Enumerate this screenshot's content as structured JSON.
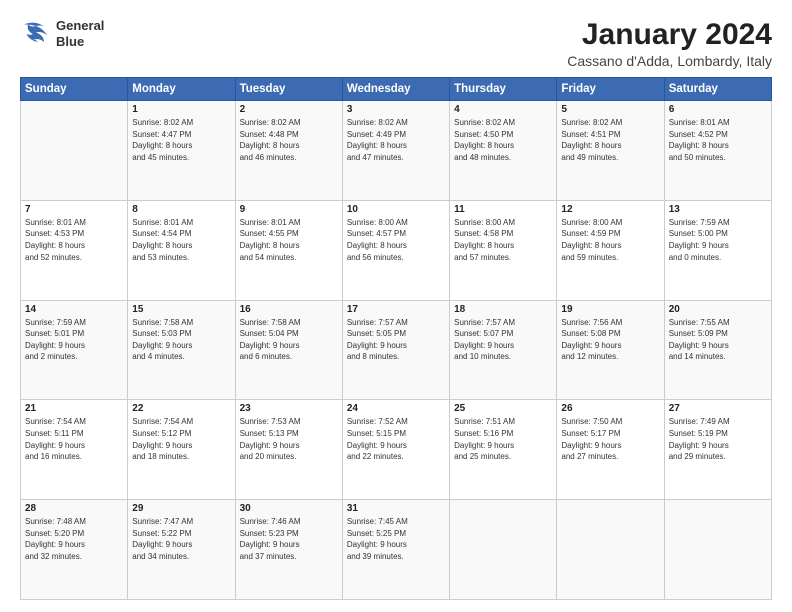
{
  "header": {
    "logo_line1": "General",
    "logo_line2": "Blue",
    "month": "January 2024",
    "location": "Cassano d'Adda, Lombardy, Italy"
  },
  "weekdays": [
    "Sunday",
    "Monday",
    "Tuesday",
    "Wednesday",
    "Thursday",
    "Friday",
    "Saturday"
  ],
  "weeks": [
    [
      {
        "day": "",
        "info": ""
      },
      {
        "day": "1",
        "info": "Sunrise: 8:02 AM\nSunset: 4:47 PM\nDaylight: 8 hours\nand 45 minutes."
      },
      {
        "day": "2",
        "info": "Sunrise: 8:02 AM\nSunset: 4:48 PM\nDaylight: 8 hours\nand 46 minutes."
      },
      {
        "day": "3",
        "info": "Sunrise: 8:02 AM\nSunset: 4:49 PM\nDaylight: 8 hours\nand 47 minutes."
      },
      {
        "day": "4",
        "info": "Sunrise: 8:02 AM\nSunset: 4:50 PM\nDaylight: 8 hours\nand 48 minutes."
      },
      {
        "day": "5",
        "info": "Sunrise: 8:02 AM\nSunset: 4:51 PM\nDaylight: 8 hours\nand 49 minutes."
      },
      {
        "day": "6",
        "info": "Sunrise: 8:01 AM\nSunset: 4:52 PM\nDaylight: 8 hours\nand 50 minutes."
      }
    ],
    [
      {
        "day": "7",
        "info": "Sunrise: 8:01 AM\nSunset: 4:53 PM\nDaylight: 8 hours\nand 52 minutes."
      },
      {
        "day": "8",
        "info": "Sunrise: 8:01 AM\nSunset: 4:54 PM\nDaylight: 8 hours\nand 53 minutes."
      },
      {
        "day": "9",
        "info": "Sunrise: 8:01 AM\nSunset: 4:55 PM\nDaylight: 8 hours\nand 54 minutes."
      },
      {
        "day": "10",
        "info": "Sunrise: 8:00 AM\nSunset: 4:57 PM\nDaylight: 8 hours\nand 56 minutes."
      },
      {
        "day": "11",
        "info": "Sunrise: 8:00 AM\nSunset: 4:58 PM\nDaylight: 8 hours\nand 57 minutes."
      },
      {
        "day": "12",
        "info": "Sunrise: 8:00 AM\nSunset: 4:59 PM\nDaylight: 8 hours\nand 59 minutes."
      },
      {
        "day": "13",
        "info": "Sunrise: 7:59 AM\nSunset: 5:00 PM\nDaylight: 9 hours\nand 0 minutes."
      }
    ],
    [
      {
        "day": "14",
        "info": "Sunrise: 7:59 AM\nSunset: 5:01 PM\nDaylight: 9 hours\nand 2 minutes."
      },
      {
        "day": "15",
        "info": "Sunrise: 7:58 AM\nSunset: 5:03 PM\nDaylight: 9 hours\nand 4 minutes."
      },
      {
        "day": "16",
        "info": "Sunrise: 7:58 AM\nSunset: 5:04 PM\nDaylight: 9 hours\nand 6 minutes."
      },
      {
        "day": "17",
        "info": "Sunrise: 7:57 AM\nSunset: 5:05 PM\nDaylight: 9 hours\nand 8 minutes."
      },
      {
        "day": "18",
        "info": "Sunrise: 7:57 AM\nSunset: 5:07 PM\nDaylight: 9 hours\nand 10 minutes."
      },
      {
        "day": "19",
        "info": "Sunrise: 7:56 AM\nSunset: 5:08 PM\nDaylight: 9 hours\nand 12 minutes."
      },
      {
        "day": "20",
        "info": "Sunrise: 7:55 AM\nSunset: 5:09 PM\nDaylight: 9 hours\nand 14 minutes."
      }
    ],
    [
      {
        "day": "21",
        "info": "Sunrise: 7:54 AM\nSunset: 5:11 PM\nDaylight: 9 hours\nand 16 minutes."
      },
      {
        "day": "22",
        "info": "Sunrise: 7:54 AM\nSunset: 5:12 PM\nDaylight: 9 hours\nand 18 minutes."
      },
      {
        "day": "23",
        "info": "Sunrise: 7:53 AM\nSunset: 5:13 PM\nDaylight: 9 hours\nand 20 minutes."
      },
      {
        "day": "24",
        "info": "Sunrise: 7:52 AM\nSunset: 5:15 PM\nDaylight: 9 hours\nand 22 minutes."
      },
      {
        "day": "25",
        "info": "Sunrise: 7:51 AM\nSunset: 5:16 PM\nDaylight: 9 hours\nand 25 minutes."
      },
      {
        "day": "26",
        "info": "Sunrise: 7:50 AM\nSunset: 5:17 PM\nDaylight: 9 hours\nand 27 minutes."
      },
      {
        "day": "27",
        "info": "Sunrise: 7:49 AM\nSunset: 5:19 PM\nDaylight: 9 hours\nand 29 minutes."
      }
    ],
    [
      {
        "day": "28",
        "info": "Sunrise: 7:48 AM\nSunset: 5:20 PM\nDaylight: 9 hours\nand 32 minutes."
      },
      {
        "day": "29",
        "info": "Sunrise: 7:47 AM\nSunset: 5:22 PM\nDaylight: 9 hours\nand 34 minutes."
      },
      {
        "day": "30",
        "info": "Sunrise: 7:46 AM\nSunset: 5:23 PM\nDaylight: 9 hours\nand 37 minutes."
      },
      {
        "day": "31",
        "info": "Sunrise: 7:45 AM\nSunset: 5:25 PM\nDaylight: 9 hours\nand 39 minutes."
      },
      {
        "day": "",
        "info": ""
      },
      {
        "day": "",
        "info": ""
      },
      {
        "day": "",
        "info": ""
      }
    ]
  ]
}
